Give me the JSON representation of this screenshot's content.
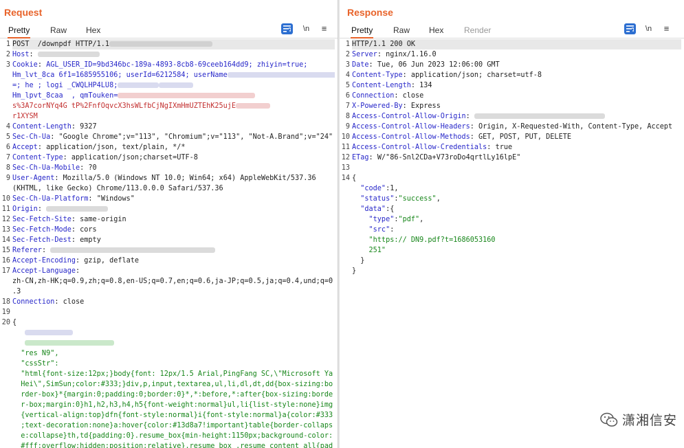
{
  "request": {
    "title": "Request",
    "tabs": [
      "Pretty",
      "Raw",
      "Hex"
    ],
    "active_tab": "Pretty",
    "tools": {
      "newline": "\\n",
      "menu": "≡"
    },
    "lines": [
      {
        "n": "1",
        "text": "POST  /downpdf HTTP/1.1"
      },
      {
        "n": "2",
        "key": "Host",
        "sep": ": ",
        "val": ""
      },
      {
        "n": "3",
        "key": "Cookie",
        "sep": ": ",
        "val": "AGL_USER_ID=9bd346bc-189a-4893-8cb8-69ceeb164dd9; zhiyin=true;"
      },
      {
        "n": "",
        "val": "Hm_lvt_8ca 6f1=1685955106; userId=6212584; userName"
      },
      {
        "n": "",
        "val": "=; he ; logi _CWQLHP4LU8;"
      },
      {
        "n": "",
        "val": "Hm_lpvt_8caa  , qmTouken="
      },
      {
        "n": "",
        "val": "s%3A7corNYq4G tP%2FnfOqvcX3hsWLfbCjNgIXmHmUZTEhK25ujE",
        "red": true
      },
      {
        "n": "",
        "val": "r1XYSM",
        "red": true
      },
      {
        "n": "4",
        "key": "Content-Length",
        "sep": ": ",
        "plain": "9327"
      },
      {
        "n": "5",
        "key": "Sec-Ch-Ua",
        "sep": ": ",
        "plain": "\"Google Chrome\";v=\"113\", \"Chromium\";v=\"113\", \"Not-A.Brand\";v=\"24\""
      },
      {
        "n": "6",
        "key": "Accept",
        "sep": ": ",
        "plain": "application/json, text/plain, */*"
      },
      {
        "n": "7",
        "key": "Content-Type",
        "sep": ": ",
        "plain": "application/json;charset=UTF-8"
      },
      {
        "n": "8",
        "key": "Sec-Ch-Ua-Mobile",
        "sep": ": ",
        "plain": "?0"
      },
      {
        "n": "9",
        "key": "User-Agent",
        "sep": ": ",
        "plain": "Mozilla/5.0 (Windows NT 10.0; Win64; x64) AppleWebKit/537.36"
      },
      {
        "n": "",
        "plain": "(KHTML, like Gecko) Chrome/113.0.0.0 Safari/537.36"
      },
      {
        "n": "10",
        "key": "Sec-Ch-Ua-Platform",
        "sep": ": ",
        "plain": "\"Windows\""
      },
      {
        "n": "11",
        "key": "Origin",
        "sep": ": ",
        "plain": ""
      },
      {
        "n": "12",
        "key": "Sec-Fetch-Site",
        "sep": ": ",
        "plain": "same-origin"
      },
      {
        "n": "13",
        "key": "Sec-Fetch-Mode",
        "sep": ": ",
        "plain": "cors"
      },
      {
        "n": "14",
        "key": "Sec-Fetch-Dest",
        "sep": ": ",
        "plain": "empty"
      },
      {
        "n": "15",
        "key": "Referer",
        "sep": ": ",
        "plain": ""
      },
      {
        "n": "16",
        "key": "Accept-Encoding",
        "sep": ": ",
        "plain": "gzip, deflate"
      },
      {
        "n": "17",
        "key": "Accept-Language",
        "sep": ":",
        "plain": ""
      },
      {
        "n": "",
        "plain": "zh-CN,zh-HK;q=0.9,zh;q=0.8,en-US;q=0.7,en;q=0.6,ja-JP;q=0.5,ja;q=0.4,und;q=0"
      },
      {
        "n": "",
        "plain": ".3"
      },
      {
        "n": "18",
        "key": "Connection",
        "sep": ": ",
        "plain": "close"
      },
      {
        "n": "19",
        "plain": ""
      },
      {
        "n": "20",
        "plain": "{"
      },
      {
        "n": "",
        "plain": ""
      },
      {
        "n": "",
        "plain": ""
      },
      {
        "n": "",
        "green": "  \"res N9\",",
        "blurw": 0
      },
      {
        "n": "",
        "green": "  \"cssStr\":"
      },
      {
        "n": "",
        "green": "  \"html{font-size:12px;}body{font: 12px/1.5 Arial,PingFang SC,\\\"Microsoft Ya"
      },
      {
        "n": "",
        "green": "  Hei\\\",SimSun;color:#333;}div,p,input,textarea,ul,li,dl,dt,dd{box-sizing:bo"
      },
      {
        "n": "",
        "green": "  rder-box}*{margin:0;padding:0;border:0}*,*:before,*:after{box-sizing:borde"
      },
      {
        "n": "",
        "green": "  r-box;margin:0}h1,h2,h3,h4,h5{font-weight:normal}ul,li{list-style:none}img"
      },
      {
        "n": "",
        "green": "  {vertical-align:top}dfn{font-style:normal}i{font-style:normal}a{color:#333"
      },
      {
        "n": "",
        "green": "  ;text-decoration:none}a:hover{color:#13d8a7!important}table{border-collaps"
      },
      {
        "n": "",
        "green": "  e:collapse}th,td{padding:0}.resume_box{min-height:1150px;background-color:"
      },
      {
        "n": "",
        "green": "  #fff;overflow:hidden;position:relative}.resume_box .resume_content_all{pad"
      }
    ]
  },
  "response": {
    "title": "Response",
    "tabs": [
      "Pretty",
      "Raw",
      "Hex",
      "Render"
    ],
    "active_tab": "Pretty",
    "tools": {
      "newline": "\\n",
      "menu": "≡"
    },
    "lines": [
      {
        "n": "1",
        "plain": "HTTP/1.1 200 OK"
      },
      {
        "n": "2",
        "key": "Server",
        "sep": ": ",
        "plain": "nginx/1.16.0"
      },
      {
        "n": "3",
        "key": "Date",
        "sep": ": ",
        "plain": "Tue, 06 Jun 2023 12:06:00 GMT"
      },
      {
        "n": "4",
        "key": "Content-Type",
        "sep": ": ",
        "plain": "application/json; charset=utf-8"
      },
      {
        "n": "5",
        "key": "Content-Length",
        "sep": ": ",
        "plain": "134"
      },
      {
        "n": "6",
        "key": "Connection",
        "sep": ": ",
        "plain": "close"
      },
      {
        "n": "7",
        "key": "X-Powered-By",
        "sep": ": ",
        "plain": "Express"
      },
      {
        "n": "8",
        "key": "Access-Control-Allow-Origin",
        "sep": ": ",
        "plain": ""
      },
      {
        "n": "9",
        "key": "Access-Control-Allow-Headers",
        "sep": ": ",
        "plain": "Origin, X-Requested-With, Content-Type, Accept"
      },
      {
        "n": "10",
        "key": "Access-Control-Allow-Methods",
        "sep": ": ",
        "plain": "GET, POST, PUT, DELETE"
      },
      {
        "n": "11",
        "key": "Access-Control-Allow-Credentials",
        "sep": ": ",
        "plain": "true"
      },
      {
        "n": "12",
        "key": "ETag",
        "sep": ": ",
        "plain": "W/\"86-Snl2CDa+V73roDo4qrtlLy16lpE\""
      },
      {
        "n": "13",
        "plain": ""
      },
      {
        "n": "14",
        "plain": "{"
      },
      {
        "n": "",
        "jk": "  \"code\"",
        "jv": "1",
        "jvtype": "num",
        "trail": ","
      },
      {
        "n": "",
        "jk": "  \"status\"",
        "jv": "\"success\"",
        "jvtype": "str",
        "trail": ","
      },
      {
        "n": "",
        "jk": "  \"data\"",
        "jv": "{",
        "jvtype": "plain",
        "trail": ""
      },
      {
        "n": "",
        "jk": "    \"type\"",
        "jv": "\"pdf\"",
        "jvtype": "str",
        "trail": ","
      },
      {
        "n": "",
        "jk": "    \"src\"",
        "jv": "",
        "jvtype": "plain",
        "trail": ""
      },
      {
        "n": "",
        "green": "    \"https:// DN9.pdf?t=1686053160"
      },
      {
        "n": "",
        "green": "    251\""
      },
      {
        "n": "",
        "plain": "  }"
      },
      {
        "n": "",
        "plain": "}"
      }
    ]
  },
  "watermark": {
    "text": "潇湘信安",
    "icon": "wechat-icon"
  },
  "colors": {
    "accent": "#e8632a",
    "header_key": "#2727c9",
    "cookie_val": "#c22e2e",
    "json_str": "#17861a",
    "button_blue": "#2d6fd1"
  }
}
